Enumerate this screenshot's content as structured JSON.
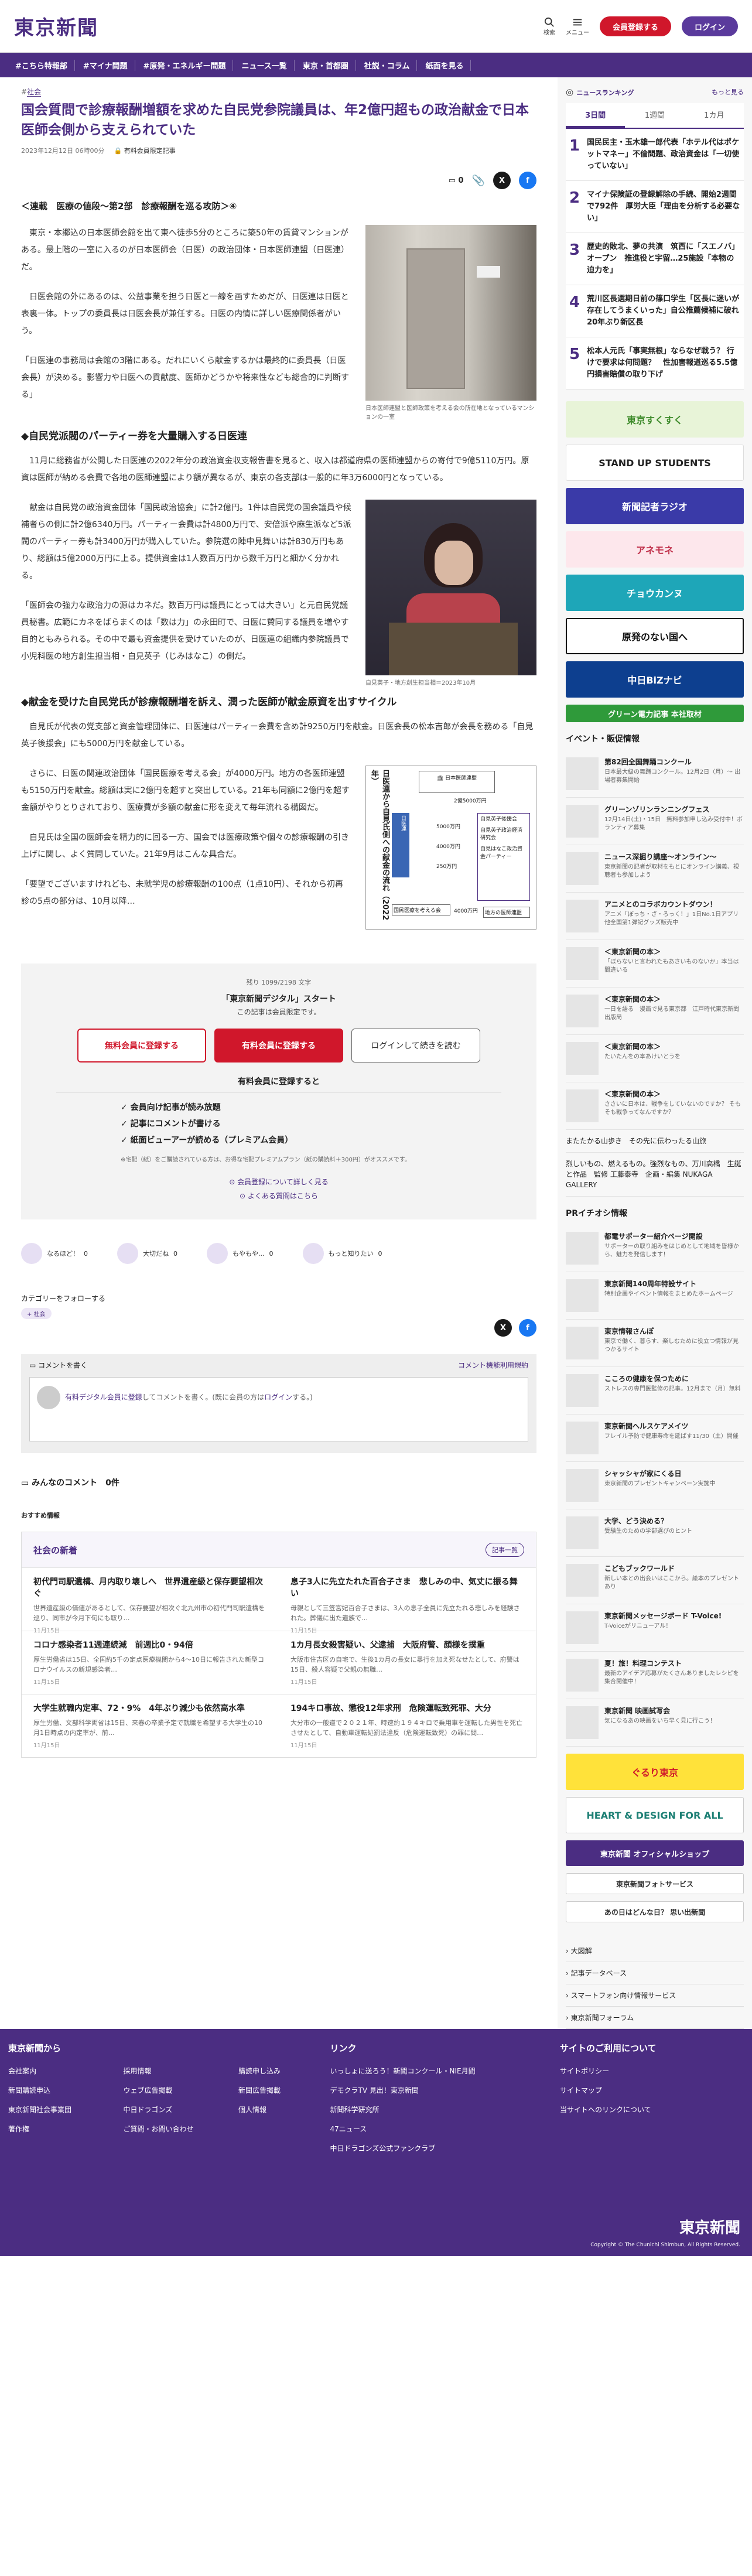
{
  "header": {
    "logo": "東京新聞",
    "search": "検索",
    "menu": "メニュー",
    "register": "会員登録する",
    "login": "ログイン"
  },
  "nav": [
    "#こちら特報部",
    "#マイナ問題",
    "#原発・エネルギー問題",
    "ニュース一覧",
    "東京・首都圏",
    "社説・コラム",
    "紙面を見る"
  ],
  "article": {
    "tag": "社会",
    "title": "国会質問で診療報酬増額を求めた自民党参院議員は、年2億円超もの政治献金で日本医師会側から支えられていた",
    "date": "2023年12月12日 06時00分",
    "member_badge": "有料会員限定記事",
    "comment_count": "0",
    "lead": "＜連載　医療の値段〜第2部　診療報酬を巡る攻防＞④",
    "p1": "　東京・本郷込の日本医師会館を出て東へ徒歩5分のところに築50年の賃貸マンションがある。最上階の一室に入るのが日本医師会（日医）の政治団体・日本医師連盟（日医連）だ。",
    "p2": "　日医会館の外にあるのは、公益事業を担う日医と一線を画すためだが、日医連は日医と表裏一体。トップの委員長は日医会長が兼任する。日医の内情に詳しい医療関係者がいう。",
    "p3": "「日医連の事務局は会館の3階にある。だれにいくら献金するかは最終的に委員長（日医会長）が決める。影響力や日医への貢献度、医師かどうかや将来性なども総合的に判断する」",
    "cap1": "日本医師連盟と医師政策を考える会の所在地となっているマンションの一室",
    "h1": "◆自民党派閥のパーティー券を大量購入する日医連",
    "p4": "　11月に総務省が公開した日医連の2022年分の政治資金収支報告書を見ると、収入は都道府県の医師連盟からの寄付で9億5110万円。原資は医師が納める会費で各地の医師連盟により額が異なるが、東京の各支部は一般的に年3万6000円となっている。",
    "p5": "　献金は自民党の政治資金団体「国民政治協会」に計2億円。1件は自民党の国会議員や候補者らの側に計2億6340万円。パーティー会費は計4800万円で、安倍派や麻生派など5派閥のパーティー券も計3400万円が購入していた。参院選の陣中見舞いは計830万円もあり、総額は5億2000万円に上る。提供資金は1人数百万円から数千万円と細かく分かれる。",
    "p6": "「医師会の強力な政治力の源はカネだ。数百万円は議員にとっては大きい」と元自民党議員秘書。広範にカネをばらまくのは「数は力」の永田町で、日医に賛同する議員を増やす目的ともみられる。その中で最も資金提供を受けていたのが、日医連の組織内参院議員で小児科医の地方創生担当相・自見英子（じみはなこ）の側だ。",
    "cap2": "自見英子・地方創生担当相＝2023年10月",
    "h2": "◆献金を受けた自民党氏が診療報酬増を訴え、潤った医師が献金原資を出すサイクル",
    "p7": "　自見氏が代表の党支部と資金管理団体に、日医連はパーティー会費を含め計9250万円を献金。日医会長の松本吉郎が会長を務める「自見英子後援会」にも5000万円を献金している。",
    "p8": "　さらに、日医の関連政治団体「国民医療を考える会」が4000万円。地方の各医師連盟も5150万円を献金。総額は実に2億円を超すと突出している。21年も同額に2億円を超す金額がやりとりされており、医療費が多額の献金に形を変えて毎年流れる構図だ。",
    "p9": "　自見氏は全国の医師会を精力的に回る一方、国会では医療政策や個々の診療報酬の引き上げに関し、よく質問していた。21年9月はこんな具合だ。",
    "p10": "「要望でございますけれども、未就学児の診療報酬の100点（1点10円）、それから初再診の5点の部分は、10月以降…",
    "diagram": {
      "title": "日医連から自見氏側への献金の流れ（2022年）",
      "top": "日本医師連盟",
      "t1": "2億5000万円",
      "left": "日医連",
      "mid": "自見英子後援会",
      "m2": "自見英子政治経済研究会",
      "m3": "自見はなこ政治資金パーティー",
      "a1": "5000万円",
      "a2": "4000万円",
      "a3": "250万円",
      "bottom": "国民医療を考える会",
      "b1": "4000万円",
      "b2": "地方の医師連盟"
    }
  },
  "paywall": {
    "count": "残り 1099/2198 文字",
    "title": "「東京新聞デジタル」スタート",
    "sub": "この記事は会員限定です。",
    "btn_free": "無料会員に登録する",
    "btn_paid": "有料会員に登録する",
    "btn_login": "ログインして続きを読む",
    "benefit_title": "有料会員に登録すると",
    "benefits": [
      "✓ 会員向け記事が読み放題",
      "✓ 記事にコメントが書ける",
      "✓ 紙面ビューアーが読める（プレミアム会員）"
    ],
    "note": "※宅配（紙）をご購読されている方は、お得な宅配プレミアムプラン（紙の購読料＋300円）がオススメです。",
    "link1": "会員登録について詳しく見る",
    "link2": "よくある質問はこちら"
  },
  "reactions": [
    "なるほど！",
    "大切だね",
    "もやもや...",
    "もっと知りたい"
  ],
  "reaction_counts": [
    "0",
    "0",
    "0",
    "0"
  ],
  "follow": {
    "label": "カテゴリーをフォローする",
    "chip": "社会"
  },
  "comments": {
    "title": "コメントを書く",
    "rules": "コメント機能利用規約",
    "prompt_pre": "有料デジタル会員に登録",
    "prompt_mid": "してコメントを書く。(既に会員の方は",
    "prompt_login": "ログイン",
    "prompt_post": "する。)",
    "list_title": "みんなのコメント",
    "list_count": "0件"
  },
  "recommend": "おすすめ情報",
  "news": {
    "title": "社会の新着",
    "more": "記事一覧",
    "items": [
      {
        "t": "初代門司駅遺構、月内取り壊しへ　世界遺産級と保存要望相次ぐ",
        "d": "世界遺産級の価値があるとして、保存要望が相次ぐ北九州市の初代門司駅遺構を巡り、同市が今月下旬にも取り…",
        "dt": "11月15日"
      },
      {
        "t": "息子3人に先立たれた百合子さま　悲しみの中、気丈に振る舞い",
        "d": "母親として三笠宮妃百合子さまは、3人の息子全員に先立たれる悲しみを経験された。葬儀に出た遺族で…",
        "dt": "11月15日"
      },
      {
        "t": "コロナ感染者11週連続減　前週比0・94倍",
        "d": "厚生労働省は15日、全国約5千の定点医療機関から4〜10日に報告された新型コロナウイルスの新規感染者…",
        "dt": "11月15日"
      },
      {
        "t": "1カ月長女殺害疑い、父逮捕　大阪府警、顔様を撲重",
        "d": "大阪市住吉区の自宅で、生後1カ月の長女に暴行を加え死なせたとして、府警は15日、殺人容疑で父親の無職…",
        "dt": "11月15日"
      },
      {
        "t": "大学生就職内定率、72・9%　4年ぶり減少も依然高水準",
        "d": "厚生労働、文部科学両省は15日、来春の卒業予定で就職を希望する大学生の10月1日時点の内定率が、前…",
        "dt": "11月15日"
      },
      {
        "t": "194キロ事故、懲役12年求刑　危険運転致死罪、大分",
        "d": "大分市の一般道で２０２１年、時速約１９４キロで乗用車を運転した男性を死亡させたとして、自動車運転処罰法違反（危険運転致死）の罪に問…",
        "dt": "11月15日"
      }
    ]
  },
  "ranking": {
    "title": "ニュースランキング",
    "more": "もっと見る",
    "tabs": [
      "3日間",
      "1週間",
      "1カ月"
    ],
    "items": [
      "国民民主・玉木雄一郎代表「ホテル代はポケットマネー」不倫問題、政治資金は「一切使っていない」",
      "マイナ保険証の登録解除の手続、開始2週間で792件　厚労大臣「理由を分析する必要ない」",
      "歴史的敗北、夢の共演　筑西に「スエノバ」オープン　推進役と宇留…25施設「本物の迫力を」",
      "荒川区長選期日前の篠口学生「区長に迷いが存在してうまくいった」自公推薦候補に破れ20年ぶり新区長",
      "松本人元氏「事実無根」ならなぜ戦う？ 行けで要求は何問題？　性加害報道巡る5.5億円損害賠償の取り下げ"
    ]
  },
  "banners": [
    "東京すくすく",
    "STAND UP STUDENTS",
    "新聞記者ラジオ",
    "アネモネ",
    "チョウカンヌ",
    "原発のない国へ",
    "中日BiZナビ",
    "グリーン電力記事 本社取材"
  ],
  "events": {
    "title": "イベント・販促情報",
    "items": [
      {
        "t": "第82回全国舞踊コンクール",
        "d": "日本最大級の舞踊コンクール。12月2日（月）〜 出場者募集開始"
      },
      {
        "t": "グリーンゾリンランニングフェス",
        "d": "12月14日(土)・15日　無料参加申し込み受付中！ボランティア募集"
      },
      {
        "t": "ニュース深掘り講座〜オンライン〜",
        "d": "東京新聞の記者が取材をもとにオンライン講義、視聴者も参加しよう"
      },
      {
        "t": "アニメとのコラボカウントダウン！",
        "d": "アニメ「ぼっち・ざ・ろっく！」1日No.1日アプリ他全国第1弾記グッズ販売中"
      },
      {
        "t": "＜東京新聞の本＞",
        "d": "「ぼらないと言われたもあさいものないか」本当は間違いる"
      },
      {
        "t": "＜東京新聞の本＞",
        "d": "一日を語る　漫画で見る東京都　江戸時代東京新聞出版局"
      },
      {
        "t": "＜東京新聞の本＞",
        "d": "たいたんをの本あけいとうを"
      },
      {
        "t": "＜東京新聞の本＞",
        "d": "ささいに日本は、戦争をしていないのですか？ そもそも戦争ってなんですか？"
      }
    ],
    "extra": [
      "またたかる山歩き　その先に伝わったる山旅",
      "烈しいもの、燃えるもの。強烈なもの、万川高橋　生誕と作品　監修 工藤泰寺　企画・編集 NUKAGA GALLERY"
    ]
  },
  "pr": {
    "title": "PRイチオシ情報",
    "items": [
      {
        "t": "都電サポーター紹介ページ開設",
        "d": "サポーターの取り組みをはじめとして地域を皆様から、魅力を発信します！"
      },
      {
        "t": "東京新聞140周年特設サイト",
        "d": "特別企画やイベント情報をまとめたホームページ"
      },
      {
        "t": "東京情報さんぽ",
        "d": "東京で働く、暮らす、楽しむために役立つ情報が見つかるサイト"
      },
      {
        "t": "こころの健康を保つために",
        "d": "ストレスの専門医監修の記事。12月まで（月）無料"
      },
      {
        "t": "東京新聞ヘルスケアメイツ",
        "d": "フレイル予防で健康寿命を延ばす11/30（土）開催"
      },
      {
        "t": "シャッシャが家にくる日",
        "d": "東京新聞のプレゼントキャンペーン実施中"
      },
      {
        "t": "大学、どう決める？",
        "d": "受験生のための学部選びのヒント"
      },
      {
        "t": "こどもブックワールド",
        "d": "新しい本との出会いはここから。絵本のプレゼントあり"
      },
      {
        "t": "東京新聞メッセージボード T-Voice!",
        "d": "T-Voiceがリニューアル！"
      },
      {
        "t": "夏！旅！料理コンテスト",
        "d": "最新のアイデア応募がたくさんありましたレシピを集合開催中！"
      },
      {
        "t": "東京新聞 映画試写会",
        "d": "気になるあの映画をいち早く見に行こう！"
      }
    ]
  },
  "side_banners": [
    "ぐるり東京",
    "HEART & DESIGN FOR ALL",
    "東京新聞 オフィシャルショップ",
    "東京新聞フォトサービス",
    "あの日はどんな日？ 思い出新聞"
  ],
  "side_links": [
    "大図解",
    "記事データベース",
    "スマートフォン向け情報サービス",
    "東京新聞フォーラム"
  ],
  "footer": {
    "c1": {
      "title": "東京新聞から",
      "items": [
        "会社案内",
        "採用情報",
        "購読申し込み",
        "新聞購読申込",
        "ウェブ広告掲載",
        "新聞広告掲載",
        "東京新聞社会事業団",
        "中日ドラゴンズ",
        "個人情報",
        "著作権",
        "ご質問・お問い合わせ"
      ]
    },
    "c2": {
      "title": "リンク",
      "items": [
        "いっしょに送ろう！新聞コンクール・NIE月間",
        "デモクラTV 見出！東京新聞",
        "新聞科学研究所",
        "47ニュース",
        "中日ドラゴンズ公式ファンクラブ"
      ]
    },
    "c3": {
      "title": "サイトのご利用について",
      "items": [
        "サイトポリシー",
        "サイトマップ",
        "当サイトへのリンクについて"
      ]
    },
    "logo": "東京新聞",
    "copy": "Copyright © The Chunichi Shimbun, All Rights Reserved."
  },
  "colors": {
    "brand": "#4b2d82",
    "red": "#d0172b"
  }
}
